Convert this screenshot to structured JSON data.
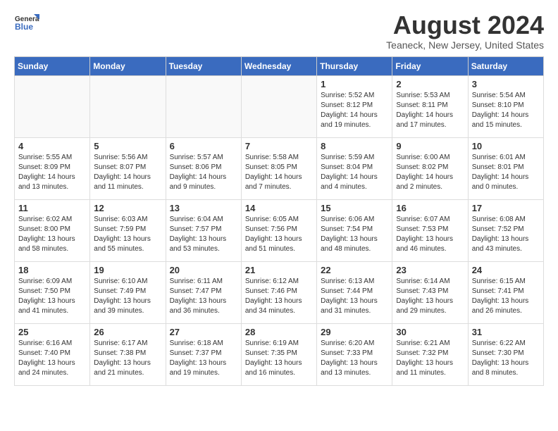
{
  "header": {
    "logo_general": "General",
    "logo_blue": "Blue",
    "month_year": "August 2024",
    "location": "Teaneck, New Jersey, United States"
  },
  "days_of_week": [
    "Sunday",
    "Monday",
    "Tuesday",
    "Wednesday",
    "Thursday",
    "Friday",
    "Saturday"
  ],
  "weeks": [
    [
      {
        "day": null,
        "content": null
      },
      {
        "day": null,
        "content": null
      },
      {
        "day": null,
        "content": null
      },
      {
        "day": null,
        "content": null
      },
      {
        "day": "1",
        "content": "Sunrise: 5:52 AM\nSunset: 8:12 PM\nDaylight: 14 hours\nand 19 minutes."
      },
      {
        "day": "2",
        "content": "Sunrise: 5:53 AM\nSunset: 8:11 PM\nDaylight: 14 hours\nand 17 minutes."
      },
      {
        "day": "3",
        "content": "Sunrise: 5:54 AM\nSunset: 8:10 PM\nDaylight: 14 hours\nand 15 minutes."
      }
    ],
    [
      {
        "day": "4",
        "content": "Sunrise: 5:55 AM\nSunset: 8:09 PM\nDaylight: 14 hours\nand 13 minutes."
      },
      {
        "day": "5",
        "content": "Sunrise: 5:56 AM\nSunset: 8:07 PM\nDaylight: 14 hours\nand 11 minutes."
      },
      {
        "day": "6",
        "content": "Sunrise: 5:57 AM\nSunset: 8:06 PM\nDaylight: 14 hours\nand 9 minutes."
      },
      {
        "day": "7",
        "content": "Sunrise: 5:58 AM\nSunset: 8:05 PM\nDaylight: 14 hours\nand 7 minutes."
      },
      {
        "day": "8",
        "content": "Sunrise: 5:59 AM\nSunset: 8:04 PM\nDaylight: 14 hours\nand 4 minutes."
      },
      {
        "day": "9",
        "content": "Sunrise: 6:00 AM\nSunset: 8:02 PM\nDaylight: 14 hours\nand 2 minutes."
      },
      {
        "day": "10",
        "content": "Sunrise: 6:01 AM\nSunset: 8:01 PM\nDaylight: 14 hours\nand 0 minutes."
      }
    ],
    [
      {
        "day": "11",
        "content": "Sunrise: 6:02 AM\nSunset: 8:00 PM\nDaylight: 13 hours\nand 58 minutes."
      },
      {
        "day": "12",
        "content": "Sunrise: 6:03 AM\nSunset: 7:59 PM\nDaylight: 13 hours\nand 55 minutes."
      },
      {
        "day": "13",
        "content": "Sunrise: 6:04 AM\nSunset: 7:57 PM\nDaylight: 13 hours\nand 53 minutes."
      },
      {
        "day": "14",
        "content": "Sunrise: 6:05 AM\nSunset: 7:56 PM\nDaylight: 13 hours\nand 51 minutes."
      },
      {
        "day": "15",
        "content": "Sunrise: 6:06 AM\nSunset: 7:54 PM\nDaylight: 13 hours\nand 48 minutes."
      },
      {
        "day": "16",
        "content": "Sunrise: 6:07 AM\nSunset: 7:53 PM\nDaylight: 13 hours\nand 46 minutes."
      },
      {
        "day": "17",
        "content": "Sunrise: 6:08 AM\nSunset: 7:52 PM\nDaylight: 13 hours\nand 43 minutes."
      }
    ],
    [
      {
        "day": "18",
        "content": "Sunrise: 6:09 AM\nSunset: 7:50 PM\nDaylight: 13 hours\nand 41 minutes."
      },
      {
        "day": "19",
        "content": "Sunrise: 6:10 AM\nSunset: 7:49 PM\nDaylight: 13 hours\nand 39 minutes."
      },
      {
        "day": "20",
        "content": "Sunrise: 6:11 AM\nSunset: 7:47 PM\nDaylight: 13 hours\nand 36 minutes."
      },
      {
        "day": "21",
        "content": "Sunrise: 6:12 AM\nSunset: 7:46 PM\nDaylight: 13 hours\nand 34 minutes."
      },
      {
        "day": "22",
        "content": "Sunrise: 6:13 AM\nSunset: 7:44 PM\nDaylight: 13 hours\nand 31 minutes."
      },
      {
        "day": "23",
        "content": "Sunrise: 6:14 AM\nSunset: 7:43 PM\nDaylight: 13 hours\nand 29 minutes."
      },
      {
        "day": "24",
        "content": "Sunrise: 6:15 AM\nSunset: 7:41 PM\nDaylight: 13 hours\nand 26 minutes."
      }
    ],
    [
      {
        "day": "25",
        "content": "Sunrise: 6:16 AM\nSunset: 7:40 PM\nDaylight: 13 hours\nand 24 minutes."
      },
      {
        "day": "26",
        "content": "Sunrise: 6:17 AM\nSunset: 7:38 PM\nDaylight: 13 hours\nand 21 minutes."
      },
      {
        "day": "27",
        "content": "Sunrise: 6:18 AM\nSunset: 7:37 PM\nDaylight: 13 hours\nand 19 minutes."
      },
      {
        "day": "28",
        "content": "Sunrise: 6:19 AM\nSunset: 7:35 PM\nDaylight: 13 hours\nand 16 minutes."
      },
      {
        "day": "29",
        "content": "Sunrise: 6:20 AM\nSunset: 7:33 PM\nDaylight: 13 hours\nand 13 minutes."
      },
      {
        "day": "30",
        "content": "Sunrise: 6:21 AM\nSunset: 7:32 PM\nDaylight: 13 hours\nand 11 minutes."
      },
      {
        "day": "31",
        "content": "Sunrise: 6:22 AM\nSunset: 7:30 PM\nDaylight: 13 hours\nand 8 minutes."
      }
    ]
  ]
}
